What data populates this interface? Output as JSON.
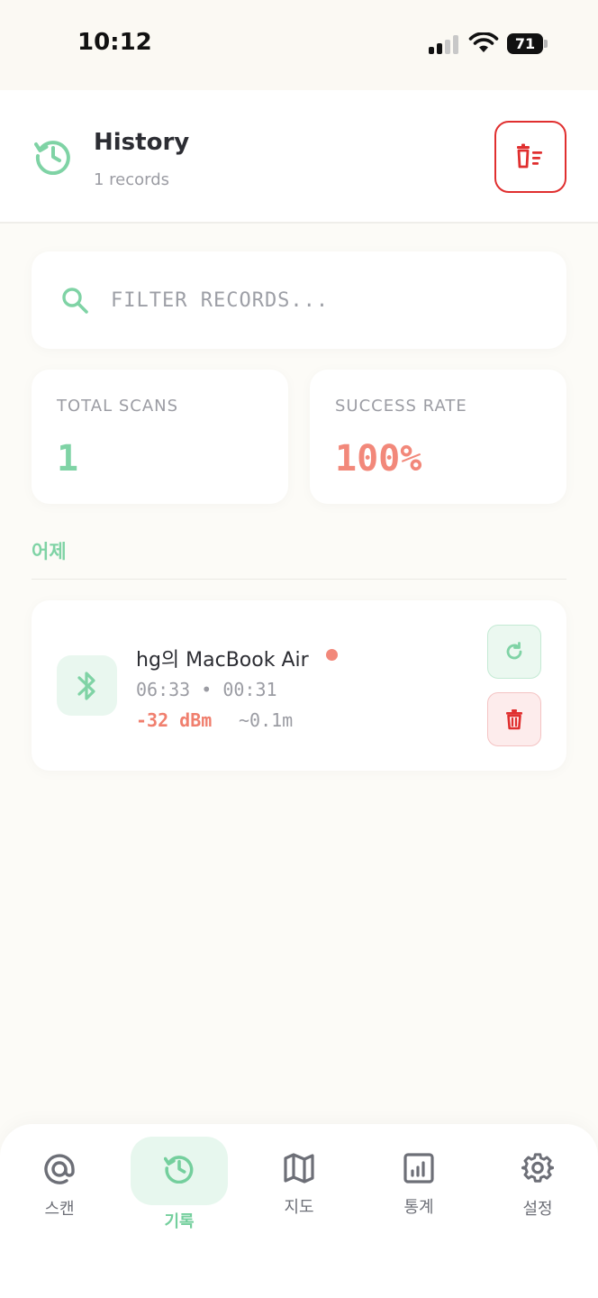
{
  "status_bar": {
    "time": "10:12",
    "battery": "71"
  },
  "header": {
    "title": "History",
    "subtitle": "1 records"
  },
  "search": {
    "placeholder": "FILTER RECORDS..."
  },
  "stats": {
    "total_scans_label": "TOTAL SCANS",
    "total_scans_value": "1",
    "success_rate_label": "SUCCESS RATE",
    "success_rate_value": "100%"
  },
  "section": {
    "label": "어제"
  },
  "records": [
    {
      "device_name": "hg의 MacBook Air",
      "times": "06:33 • 00:31",
      "rssi": "-32 dBm",
      "distance": "~0.1m"
    }
  ],
  "nav": {
    "items": [
      {
        "label": "스캔",
        "icon": "at-icon"
      },
      {
        "label": "기록",
        "icon": "history-icon"
      },
      {
        "label": "지도",
        "icon": "map-icon"
      },
      {
        "label": "통계",
        "icon": "chart-icon"
      },
      {
        "label": "설정",
        "icon": "gear-icon"
      }
    ],
    "active_index": 1
  },
  "colors": {
    "accent_green": "#7fd3a5",
    "accent_red": "#e02f2f",
    "rssi_coral": "#f07f6e",
    "background": "#fcfbf7"
  }
}
